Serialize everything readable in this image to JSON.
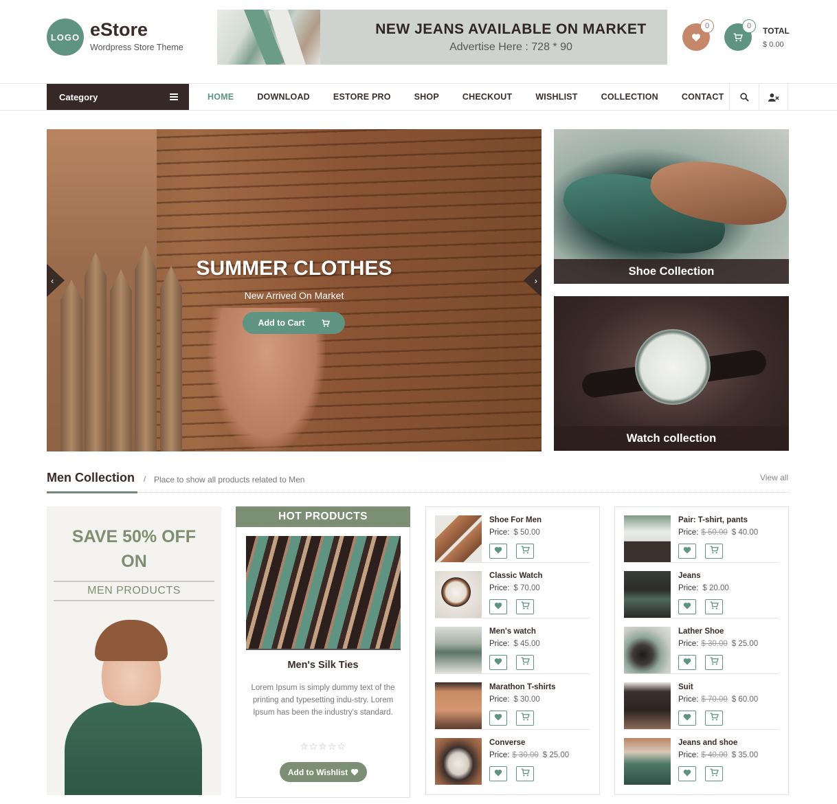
{
  "header": {
    "logo_text": "LOGO",
    "site_title": "eStore",
    "tagline": "Wordpress Store Theme",
    "ad_title": "NEW JEANS AVAILABLE ON MARKET",
    "ad_subtitle": "Advertise Here : 728 * 90",
    "wishlist_count": "0",
    "cart_count": "0",
    "total_label": "TOTAL",
    "total_value": "$ 0.00"
  },
  "nav": {
    "category_label": "Category",
    "menu": [
      {
        "label": "HOME",
        "active": true
      },
      {
        "label": "DOWNLOAD"
      },
      {
        "label": "ESTORE PRO"
      },
      {
        "label": "SHOP"
      },
      {
        "label": "CHECKOUT"
      },
      {
        "label": "WISHLIST"
      },
      {
        "label": "COLLECTION"
      },
      {
        "label": "CONTACT"
      }
    ],
    "icons": [
      "search-icon",
      "user-times-icon"
    ]
  },
  "slider": {
    "title": "SUMMER CLOTHES",
    "subtitle": "New Arrived On Market",
    "button_label": "Add to Cart"
  },
  "promos": {
    "shoe_caption": "Shoe Collection",
    "watch_caption": "Watch collection"
  },
  "section": {
    "title": "Men Collection",
    "separator": "/",
    "description": "Place to show all products related to Men",
    "view_all": "View all"
  },
  "save_banner": {
    "line1": "SAVE 50% OFF",
    "line2": "ON",
    "line3": "MEN PRODUCTS"
  },
  "hot": {
    "header": "HOT PRODUCTS",
    "name": "Men's Silk Ties",
    "description": "Lorem Ipsum is simply dummy text of the printing and typesetting indu-stry. Lorem Ipsum has been the industry's standard.",
    "stars": "☆☆☆☆☆",
    "rating": 0,
    "button_label": "Add to Wishlist"
  },
  "list1": [
    {
      "name": "Shoe For Men",
      "price_label": "Price:",
      "old_price": "",
      "price": "$ 50.00"
    },
    {
      "name": "Classic Watch",
      "price_label": "Price:",
      "old_price": "",
      "price": "$ 70.00"
    },
    {
      "name": "Men's watch",
      "price_label": "Price:",
      "old_price": "",
      "price": "$ 45.00"
    },
    {
      "name": "Marathon T-shirts",
      "price_label": "Price:",
      "old_price": "",
      "price": "$ 30.00"
    },
    {
      "name": "Converse",
      "price_label": "Price:",
      "old_price": "$ 30.00",
      "price": "$ 25.00"
    }
  ],
  "list2": [
    {
      "name": "Pair: T-shirt, pants",
      "price_label": "Price:",
      "old_price": "$ 50.00",
      "price": "$ 40.00"
    },
    {
      "name": "Jeans",
      "price_label": "Price:",
      "old_price": "",
      "price": "$ 20.00"
    },
    {
      "name": "Lather Shoe",
      "price_label": "Price:",
      "old_price": "$ 30.00",
      "price": "$ 25.00"
    },
    {
      "name": "Suit",
      "price_label": "Price:",
      "old_price": "$ 70.00",
      "price": "$ 60.00"
    },
    {
      "name": "Jeans and shoe",
      "price_label": "Price:",
      "old_price": "$ 40.00",
      "price": "$ 35.00"
    }
  ],
  "colors": {
    "accent": "#5f9483",
    "dark_brown": "#362826",
    "copper": "#c4876a",
    "olive": "#7c8f74"
  }
}
